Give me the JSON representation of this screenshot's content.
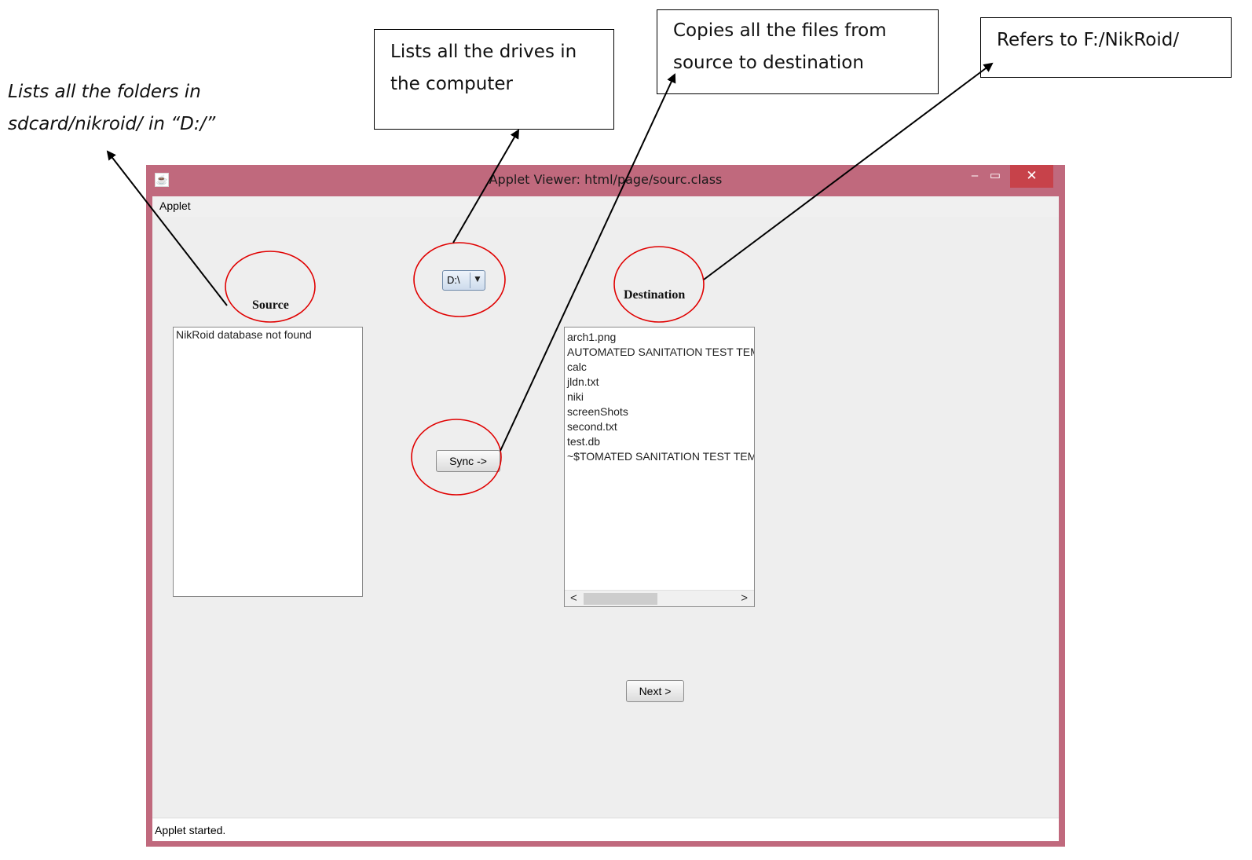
{
  "annotations": {
    "folders_note": "Lists all the folders in\nsdcard/nikroid/ in “D:/”",
    "drives_note": "Lists all the drives in\nthe computer",
    "copy_note": "Copies all the files from\nsource to destination",
    "refers_note": "Refers to F:/NikRoid/"
  },
  "window": {
    "title": "Applet Viewer: html/page/sourc.class",
    "minimize_glyph": "–",
    "maximize_glyph": "▭",
    "close_glyph": "✕",
    "icon": "java-icon"
  },
  "menu": {
    "applet": "Applet"
  },
  "source": {
    "heading": "Source",
    "items": [
      "NikRoid database not found"
    ]
  },
  "drive_select": {
    "value": "D:\\",
    "arrow": "▼"
  },
  "sync_button": "Sync ->",
  "destination": {
    "heading": "Destination",
    "items": [
      "arch1.png",
      "AUTOMATED SANITATION TEST TEMPLATE",
      "calc",
      "jldn.txt",
      "niki",
      "screenShots",
      "second.txt",
      "test.db",
      "~$TOMATED SANITATION TEST TEMPLATE"
    ],
    "scroll_left": "<",
    "scroll_right": ">"
  },
  "next_button": "Next >",
  "status": "Applet started.",
  "colors": {
    "window_frame": "#c0697d",
    "close_button": "#c7424a",
    "highlight_circle": "#e00000"
  }
}
